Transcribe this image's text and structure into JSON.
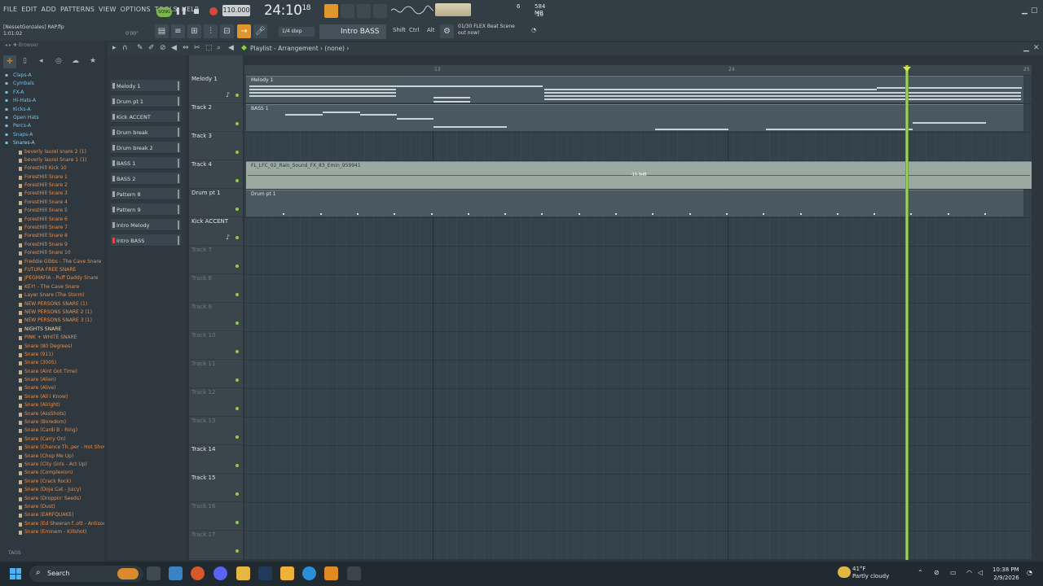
{
  "menu": [
    "FILE",
    "EDIT",
    "ADD",
    "PATTERNS",
    "VIEW",
    "OPTIONS",
    "TOOLS",
    "HELP"
  ],
  "transport": {
    "mode": "SONG",
    "tempo": "110.000",
    "time_main": "24:10",
    "time_sub": "18"
  },
  "cpu": {
    "value1": "6",
    "memory": "584 MB",
    "value3": "10"
  },
  "project": {
    "name": "[NessetGonzales] RAP.flp",
    "position": "1:01:02",
    "hint_time": "0'00\""
  },
  "toolbar": {
    "snap": "1/4 step",
    "pattern": "Intro BASS",
    "mod_shift": "Shift",
    "mod_ctrl": "Ctrl",
    "mod_alt": "Alt",
    "news_counter": "01/30",
    "news_text": "FLEX Beat Scene",
    "news_sub": "out now!"
  },
  "browser": {
    "title": "Browser",
    "items": [
      {
        "label": "Claps-A",
        "kind": "folder"
      },
      {
        "label": "Cymbals",
        "kind": "folder"
      },
      {
        "label": "FX-A",
        "kind": "folder"
      },
      {
        "label": "Hi-Hats-A",
        "kind": "folder"
      },
      {
        "label": "Kicks-A",
        "kind": "folder"
      },
      {
        "label": "Open Hats",
        "kind": "folder"
      },
      {
        "label": "Percs-A",
        "kind": "folder"
      },
      {
        "label": "Snaps-A",
        "kind": "folder"
      },
      {
        "label": "Snares-A",
        "kind": "folder open"
      },
      {
        "label": "beverly laurel snare 2 (1)",
        "kind": "file"
      },
      {
        "label": "beverly laurel Snare 1 (1)",
        "kind": "file"
      },
      {
        "label": "ForestHill Kick 10",
        "kind": "file"
      },
      {
        "label": "ForestHill Snare 1",
        "kind": "file"
      },
      {
        "label": "ForestHill Snare 2",
        "kind": "file"
      },
      {
        "label": "ForestHill Snare 3",
        "kind": "file"
      },
      {
        "label": "ForestHill Snare 4",
        "kind": "file"
      },
      {
        "label": "ForestHill Snare 5",
        "kind": "file"
      },
      {
        "label": "ForestHill Snare 6",
        "kind": "file"
      },
      {
        "label": "ForestHill Snare 7",
        "kind": "file"
      },
      {
        "label": "ForestHill Snare 8",
        "kind": "file"
      },
      {
        "label": "ForestHill Snare 9",
        "kind": "file"
      },
      {
        "label": "ForestHill Snare 10",
        "kind": "file"
      },
      {
        "label": "Freddie Gibbs - The Cave Snare",
        "kind": "file"
      },
      {
        "label": "FUTURA FREE SNARE",
        "kind": "file"
      },
      {
        "label": "JPEGMAFIA - Puff Daddy Snare",
        "kind": "file"
      },
      {
        "label": "KEY! - The Cave Snare",
        "kind": "file"
      },
      {
        "label": "Layer Snare (The Storm)",
        "kind": "file"
      },
      {
        "label": "NEW PERSONS SNARE (1)",
        "kind": "file"
      },
      {
        "label": "NEW PERSONS SNARE 2 (1)",
        "kind": "file"
      },
      {
        "label": "NEW PERSONS SNARE 3 (1)",
        "kind": "file"
      },
      {
        "label": "NIGHTS SNARE",
        "kind": "file sel"
      },
      {
        "label": "PINK + WHITE SNARE",
        "kind": "file"
      },
      {
        "label": "Snare (80 Degrees)",
        "kind": "file"
      },
      {
        "label": "Snare (911)",
        "kind": "file"
      },
      {
        "label": "Snare (3005)",
        "kind": "file"
      },
      {
        "label": "Snare (Aint Got Time)",
        "kind": "file"
      },
      {
        "label": "Snare (Alien)",
        "kind": "file"
      },
      {
        "label": "Snare (Alive)",
        "kind": "file"
      },
      {
        "label": "Snare (All I Know)",
        "kind": "file"
      },
      {
        "label": "Snare (Alright)",
        "kind": "file"
      },
      {
        "label": "Snare (AssShots)",
        "kind": "file"
      },
      {
        "label": "Snare (Boredom)",
        "kind": "file"
      },
      {
        "label": "Snare (Cardi B - Ring)",
        "kind": "file"
      },
      {
        "label": "Snare (Carry On)",
        "kind": "file"
      },
      {
        "label": "Snare (Chance Th..per - Hot Shower)",
        "kind": "file"
      },
      {
        "label": "Snare (Chop Me Up)",
        "kind": "file"
      },
      {
        "label": "Snare (City Girls - Act Up)",
        "kind": "file"
      },
      {
        "label": "Snare (Complexion)",
        "kind": "file"
      },
      {
        "label": "Snare (Crack Rock)",
        "kind": "file"
      },
      {
        "label": "Snare (Doja Cat - Juicy)",
        "kind": "file"
      },
      {
        "label": "Snare (Droppin' Seeds)",
        "kind": "file"
      },
      {
        "label": "Snare (Dust)",
        "kind": "file"
      },
      {
        "label": "Snare (EARFQUAKE)",
        "kind": "file"
      },
      {
        "label": "Snare (Ed Sheeran f..ott - Antisocial)",
        "kind": "file"
      },
      {
        "label": "Snare (Eminem - Killshot)",
        "kind": "file"
      }
    ],
    "tags_label": "TAGS"
  },
  "channels": [
    "Melody 1",
    "Drum pt 1",
    "Kick ACCENT",
    "Drum break",
    "Drum break 2",
    "BASS 1",
    "BASS 2",
    "Pattern 8",
    "Pattern 9",
    "Intro Melody",
    "Intro BASS"
  ],
  "playlist": {
    "title": "Playlist - Arrangement",
    "sep": "›",
    "clip_source": "(none)",
    "timeline_marks": [
      "13",
      "24",
      "25"
    ],
    "tracks": [
      {
        "label": "Melody 1",
        "active": true
      },
      {
        "label": "Track 2",
        "active": true
      },
      {
        "label": "Track 3",
        "active": true
      },
      {
        "label": "Track 4",
        "active": true
      },
      {
        "label": "Drum pt 1",
        "active": true
      },
      {
        "label": "Kick ACCENT",
        "active": true
      },
      {
        "label": "Track 7",
        "active": false
      },
      {
        "label": "Track 8",
        "active": false
      },
      {
        "label": "Track 9",
        "active": false
      },
      {
        "label": "Track 10",
        "active": false
      },
      {
        "label": "Track 11",
        "active": false
      },
      {
        "label": "Track 12",
        "active": false
      },
      {
        "label": "Track 13",
        "active": false
      },
      {
        "label": "Track 14",
        "active": true
      },
      {
        "label": "Track 15",
        "active": true
      },
      {
        "label": "Track 16",
        "active": false
      },
      {
        "label": "Track 17",
        "active": false
      }
    ],
    "clips": {
      "melody": "Melody 1",
      "bass": "BASS 1",
      "audio": "FL_LFC_02_Rain_Sound_FX_83_Emin_959941",
      "audio_db": "-15.9dB",
      "drum": "Drum pt 1"
    }
  },
  "taskbar": {
    "search": "Search",
    "weather_temp": "41°F",
    "weather_desc": "Partly cloudy",
    "time": "10:38 PM",
    "date": "2/9/2026"
  },
  "colors": {
    "accent": "#f0a93c",
    "playhead": "#b6e66a",
    "track_led": "#8fcf3c",
    "record": "#d8483a"
  }
}
